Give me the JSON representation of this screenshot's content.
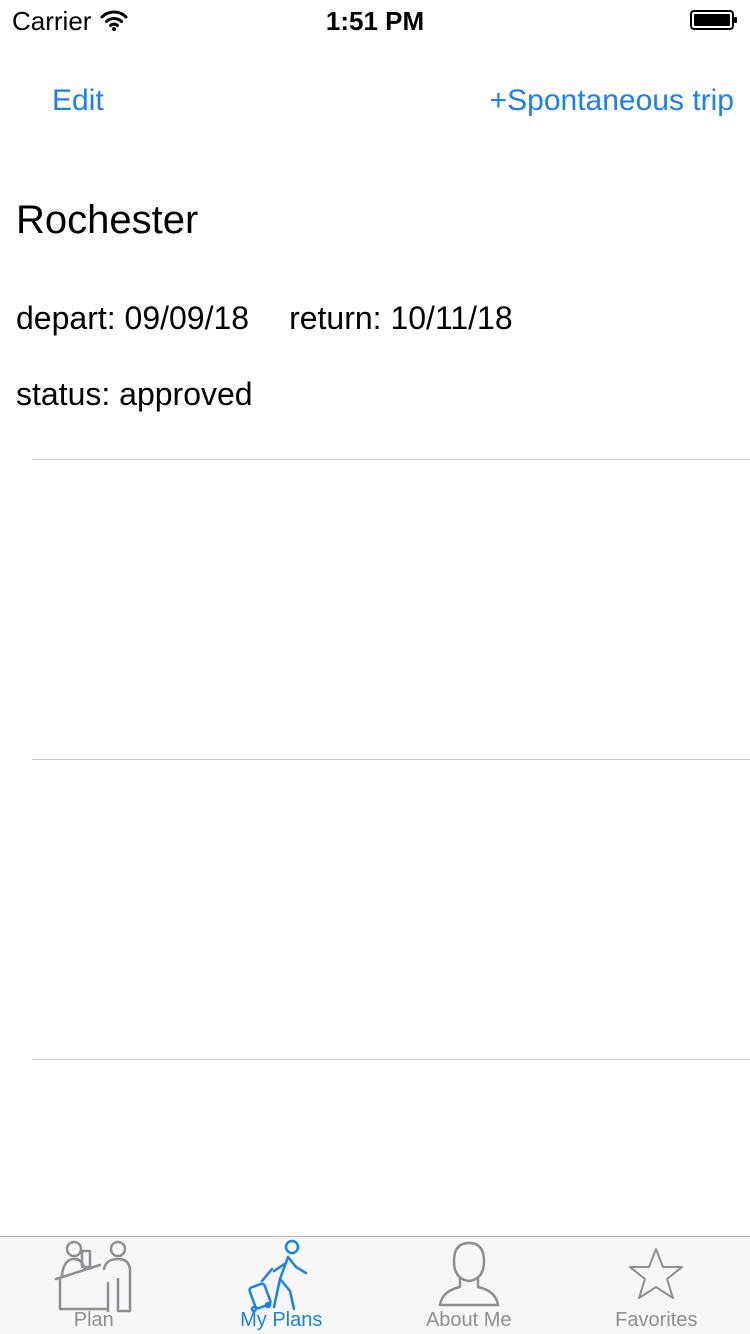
{
  "status_bar": {
    "carrier": "Carrier",
    "time": "1:51 PM",
    "wifi_icon": "wifi-icon",
    "battery_icon": "battery-icon"
  },
  "nav": {
    "left_label": "Edit",
    "right_label": "+Spontaneous trip"
  },
  "trip": {
    "title": "Rochester",
    "depart": "depart: 09/09/18",
    "return": "return: 10/11/18",
    "status": "status: approved"
  },
  "tabs": [
    {
      "label": "Plan",
      "icon": "reception-desk-icon",
      "active": false
    },
    {
      "label": "My Plans",
      "icon": "traveler-luggage-icon",
      "active": true
    },
    {
      "label": "About Me",
      "icon": "person-icon",
      "active": false
    },
    {
      "label": "Favorites",
      "icon": "star-icon",
      "active": false
    }
  ],
  "colors": {
    "accent": "#1a7ff0",
    "inactive_tab": "#8e8e93",
    "separator": "#c8c7cc"
  }
}
